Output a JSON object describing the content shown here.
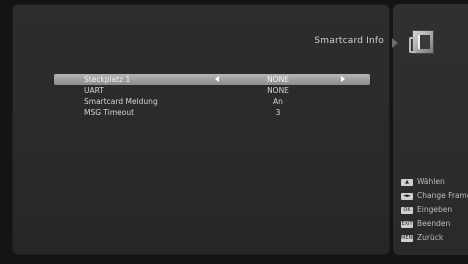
{
  "screen": {
    "title": "Smartcard Info"
  },
  "menu": {
    "rows": [
      {
        "label": "Steckplatz 1",
        "value": "NONE",
        "selected": true
      },
      {
        "label": "UART",
        "value": "NONE",
        "selected": false
      },
      {
        "label": "Smartcard Meldung",
        "value": "An",
        "selected": false
      },
      {
        "label": "MSG Timeout",
        "value": "3",
        "selected": false
      }
    ]
  },
  "legend": {
    "items": [
      {
        "key": "▲",
        "label": "Wählen"
      },
      {
        "key": "◄►",
        "label": "Change Frame"
      },
      {
        "key": "OK",
        "label": "Eingeben"
      },
      {
        "key": "EXIT",
        "label": "Beenden"
      },
      {
        "key": "MENU",
        "label": "Zurück"
      }
    ]
  },
  "colors": {
    "background": "#141414",
    "panel": "#2b2b2b",
    "selected_row": "#a0a0a0",
    "text": "#d4d4d4"
  }
}
